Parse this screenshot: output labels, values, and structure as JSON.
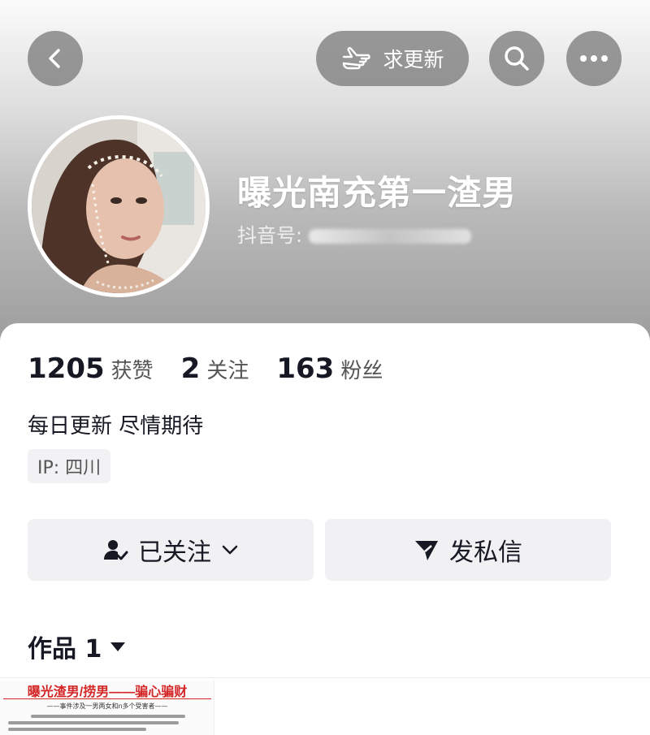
{
  "topbar": {
    "back_icon": "back-chevron-icon",
    "update_label": "求更新",
    "update_icon": "pointing-hand-icon",
    "search_icon": "search-icon",
    "more_icon": "more-dots-icon"
  },
  "profile": {
    "name": "曝光南充第一渣男",
    "douyin_id_label": "抖音号:",
    "douyin_id_value": "",
    "stats": [
      {
        "value": "1205",
        "label": "获赞"
      },
      {
        "value": "2",
        "label": "关注"
      },
      {
        "value": "163",
        "label": "粉丝"
      }
    ],
    "bio": "每日更新 尽情期待",
    "ip": "IP:  四川"
  },
  "actions": {
    "follow_label": "已关注",
    "message_label": "发私信"
  },
  "works": {
    "label": "作品 1"
  },
  "thumbnail": {
    "title": "曝光渣男/捞男——骗心骗财",
    "subtitle": "——事件涉及一男两女和n多个受害者——"
  },
  "colors": {
    "accent_red": "#d42626",
    "text_dark": "#161823",
    "button_bg": "#f1f1f3"
  }
}
